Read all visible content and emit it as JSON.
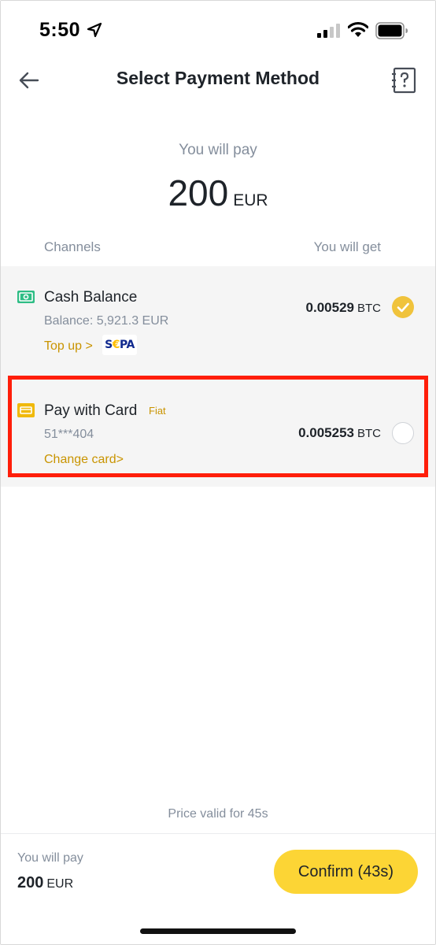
{
  "status_bar": {
    "time": "5:50",
    "icons": [
      "location-arrow-icon",
      "cellular-signal-icon",
      "wifi-icon",
      "battery-icon"
    ]
  },
  "header": {
    "title": "Select Payment Method",
    "back_icon": "arrow-left-icon",
    "help_icon": "help-document-icon"
  },
  "payment": {
    "label": "You will pay",
    "amount": "200",
    "currency": "EUR"
  },
  "channels": {
    "header_left": "Channels",
    "header_right": "You will get"
  },
  "options": [
    {
      "title": "Cash Balance",
      "subtitle": "Balance:  5,921.3 EUR",
      "link": "Top up >",
      "logo_text_1": "S",
      "logo_text_2": "€",
      "logo_text_3": "PA",
      "value": "0.00529",
      "unit": "BTC",
      "selected": true,
      "icon": "cash-icon"
    },
    {
      "title": "Pay with Card",
      "badge": "Fiat",
      "subtitle": "51***404",
      "link": "Change card>",
      "value": "0.005253",
      "unit": "BTC",
      "selected": false,
      "icon": "card-icon"
    }
  ],
  "price_valid": "Price valid for 45s",
  "footer": {
    "label": "You will pay",
    "amount": "200",
    "currency": "EUR",
    "confirm_label": "Confirm (43s)"
  },
  "colors": {
    "accent_yellow": "#fcd535",
    "link_gold": "#c99400",
    "highlight_red": "#ff1e0a",
    "cash_green": "#2ebd85"
  }
}
